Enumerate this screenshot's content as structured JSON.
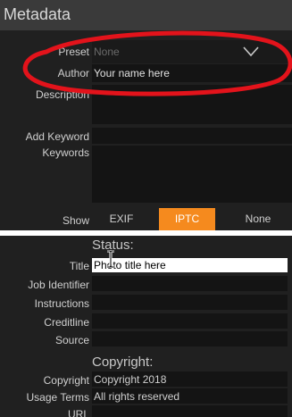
{
  "metadata_panel": {
    "title": "Metadata",
    "preset_label": "Preset",
    "preset_value": "None",
    "author_label": "Author",
    "author_value": "Your name here",
    "description_label": "Description",
    "description_value": "",
    "add_keyword_label": "Add Keyword",
    "add_keyword_value": "",
    "keywords_label": "Keywords",
    "keywords_value": "",
    "show_label": "Show",
    "show_options": [
      "EXIF",
      "IPTC",
      "None"
    ],
    "show_selected": "IPTC"
  },
  "status_panel": {
    "status_heading": "Status:",
    "title_label": "Title",
    "title_value": "Photo title here",
    "job_identifier_label": "Job Identifier",
    "instructions_label": "Instructions",
    "creditline_label": "Creditline",
    "source_label": "Source",
    "copyright_heading": "Copyright:",
    "copyright_label": "Copyright",
    "copyright_value": "Copyright 2018",
    "usage_terms_label": "Usage Terms",
    "usage_terms_value": "All rights reserved",
    "url_label": "URL"
  },
  "colors": {
    "accent": "#f58a1e",
    "annotation_ellipse": "#e3131b",
    "panel_bg": "#202020",
    "field_bg": "#141414"
  },
  "icons": {
    "preset_dropdown": "chevron-down-icon",
    "text_cursor": "i-beam-cursor-icon"
  }
}
